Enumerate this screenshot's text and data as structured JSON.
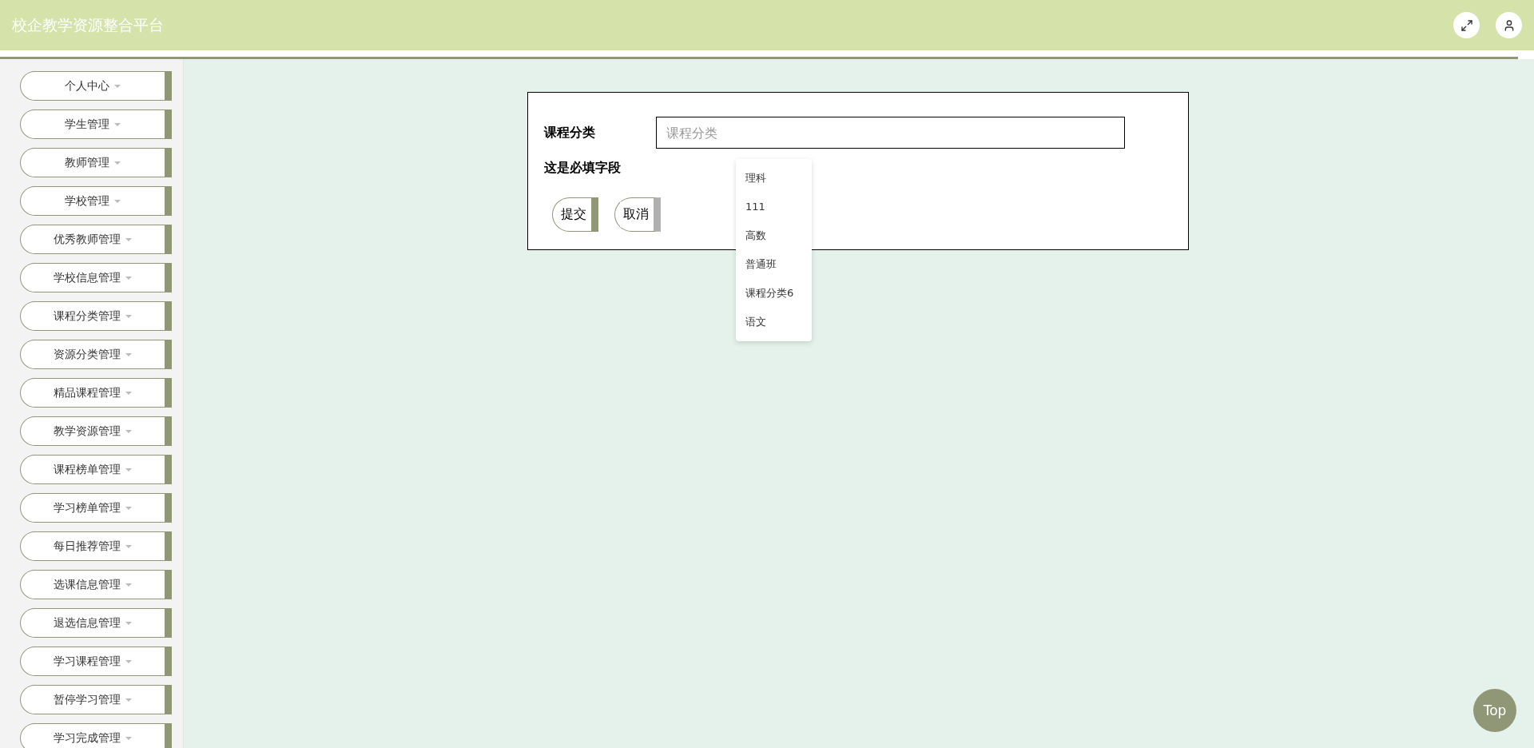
{
  "header": {
    "title": "校企教学资源整合平台"
  },
  "sidebar": {
    "items": [
      {
        "label": "个人中心"
      },
      {
        "label": "学生管理"
      },
      {
        "label": "教师管理"
      },
      {
        "label": "学校管理"
      },
      {
        "label": "优秀教师管理"
      },
      {
        "label": "学校信息管理"
      },
      {
        "label": "课程分类管理"
      },
      {
        "label": "资源分类管理"
      },
      {
        "label": "精品课程管理"
      },
      {
        "label": "教学资源管理"
      },
      {
        "label": "课程榜单管理"
      },
      {
        "label": "学习榜单管理"
      },
      {
        "label": "每日推荐管理"
      },
      {
        "label": "选课信息管理"
      },
      {
        "label": "退选信息管理"
      },
      {
        "label": "学习课程管理"
      },
      {
        "label": "暂停学习管理"
      },
      {
        "label": "学习完成管理"
      }
    ]
  },
  "form": {
    "field": {
      "label": "课程分类",
      "placeholder": "课程分类"
    },
    "hint": "这是必填字段",
    "suggestions": [
      "理科",
      "111",
      "高数",
      "普通班",
      "课程分类6",
      "语文"
    ],
    "buttons": [
      {
        "label": "提交",
        "kind": "primary"
      },
      {
        "label": "取消",
        "kind": "secondary"
      }
    ]
  },
  "top_button": "Top"
}
